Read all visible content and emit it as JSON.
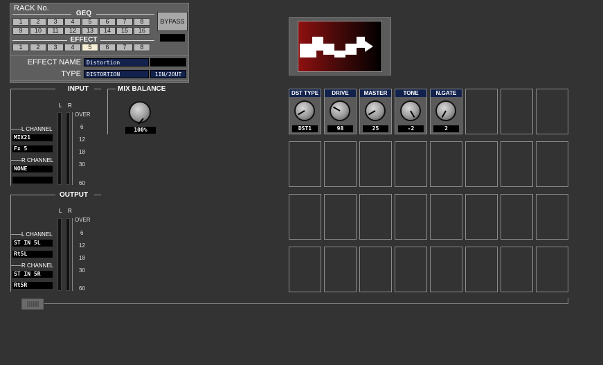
{
  "rack": {
    "title": "RACK No.",
    "geq_label": "GEQ",
    "geq_buttons": [
      "1",
      "2",
      "3",
      "4",
      "5",
      "6",
      "7",
      "8",
      "9",
      "10",
      "11",
      "12",
      "13",
      "14",
      "15",
      "16"
    ],
    "effect_label": "EFFECT",
    "effect_buttons": [
      "1",
      "2",
      "3",
      "4",
      "5",
      "6",
      "7",
      "8"
    ],
    "effect_selected": "5",
    "bypass_label": "BYPASS"
  },
  "effect": {
    "name_label": "EFFECT NAME",
    "name_value": "Distortion",
    "type_label": "TYPE",
    "type_value": "DISTORTION",
    "io_value": "1IN/2OUT"
  },
  "input": {
    "title": "INPUT",
    "l_label": "L",
    "r_label": "R",
    "l_channel_label": "L CHANNEL",
    "l_channel_values": [
      "MIX21",
      "Fx 5"
    ],
    "r_channel_label": "R CHANNEL",
    "r_channel_values": [
      "NONE",
      ""
    ],
    "scale": [
      "OVER",
      "6",
      "12",
      "18",
      "30",
      "60"
    ]
  },
  "output": {
    "title": "OUTPUT",
    "l_label": "L",
    "r_label": "R",
    "l_channel_label": "L CHANNEL",
    "l_channel_values": [
      "ST IN 5L",
      "Rt5L"
    ],
    "r_channel_label": "R CHANNEL",
    "r_channel_values": [
      "ST IN 5R",
      "Rt5R"
    ],
    "scale": [
      "OVER",
      "6",
      "12",
      "18",
      "30",
      "60"
    ]
  },
  "mix_balance": {
    "title": "MIX BALANCE",
    "value": "100%"
  },
  "params": [
    {
      "name": "DST TYPE",
      "value": "DST1"
    },
    {
      "name": "DRIVE",
      "value": "98"
    },
    {
      "name": "MASTER",
      "value": "25"
    },
    {
      "name": "TONE",
      "value": "-2"
    },
    {
      "name": "N.GATE",
      "value": "2"
    }
  ],
  "icons": {
    "effect_icon": "distortion-wave-icon"
  }
}
